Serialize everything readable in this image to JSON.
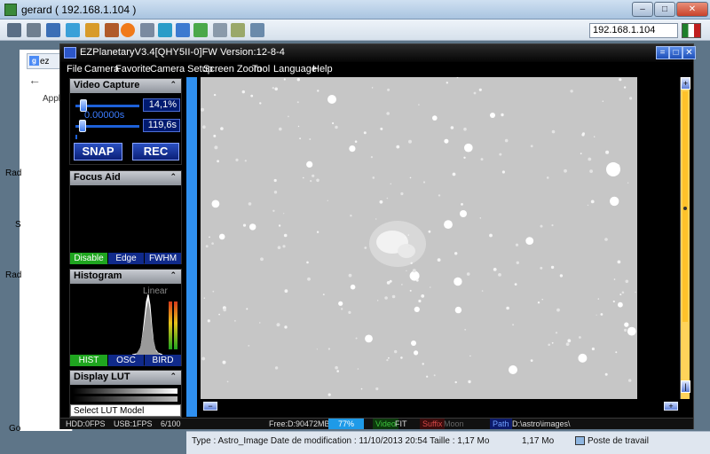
{
  "remote_window": {
    "title": "gerard ( 192.168.1.104 )",
    "address": "192.168.1.104",
    "min_glyph": "–",
    "max_glyph": "□",
    "close_glyph": "✕"
  },
  "desktop": {
    "browser_tab_label": "ez",
    "apps_label": "Applic",
    "labels": [
      "Rad",
      "S",
      "Rad",
      "Go"
    ]
  },
  "explorer": {
    "details": "Type : Astro_Image Date de modification : 11/10/2013 20:54 Taille : 1,17 Mo",
    "size": "1,17 Mo",
    "location": "Poste de travail"
  },
  "app": {
    "title": "EZPlanetaryV3.4[QHY5II-0]FW Version:12-8-4",
    "window_buttons": [
      "=",
      "□",
      "✕"
    ],
    "menu": [
      "File",
      "Camera",
      "Favorite",
      "Camera Setup",
      "Screen Zoom",
      "Tool",
      "Language",
      "Help"
    ]
  },
  "video_capture": {
    "header": "Video Capture",
    "gain_value": "14,1%",
    "exposure_value": "119,6s",
    "exposure_overlay": "0.00000s",
    "gain_level": 0.141,
    "snap_label": "SNAP",
    "rec_label": "REC"
  },
  "focus_aid": {
    "header": "Focus Aid",
    "modes": [
      "Disable",
      "Edge",
      "FWHM"
    ],
    "active_mode": "Disable"
  },
  "histogram": {
    "header": "Histogram",
    "scale_label": "Linear",
    "tabs": [
      "HIST",
      "OSC",
      "BIRD"
    ]
  },
  "display_lut": {
    "header": "Display LUT",
    "select_placeholder": "Select LUT Model"
  },
  "zoom": {
    "out_glyph": "−",
    "in_glyph": "+"
  },
  "scroll": {
    "up_glyph": "+",
    "down_glyph": "|"
  },
  "status": {
    "hdd": "HDD:0FPS",
    "usb": "USB:1FPS",
    "frames": "6/100",
    "free": "Free:D:90472MB",
    "percent": "77%",
    "video_label": "Video",
    "video_format": "FIT",
    "suffix_label": "Suffix",
    "suffix_value": "Moon",
    "path_label": "Path",
    "path_value": "D:\\astro\\images\\"
  },
  "colors": {
    "accent_blue": "#1d60d8",
    "scroll_yellow": "#ffd35a",
    "active_green": "#1fa51f"
  }
}
